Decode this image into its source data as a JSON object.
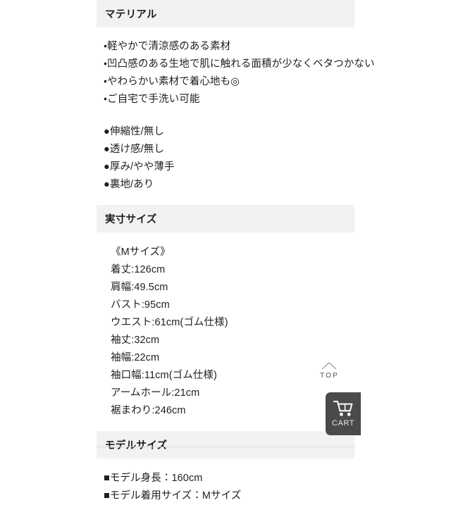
{
  "sections": [
    {
      "id": "material",
      "title": "マテリアル",
      "feature_lines": [
        "・軽やかで清涼感のある素材",
        "・凹凸感のある生地で肌に触れる面積が少なくベタつかない",
        "・やわらかい素材で着心地も◎",
        "・ご自宅で手洗い可能"
      ],
      "spec_lines": [
        "●伸縮性/無し",
        "●透け感/無し",
        "●厚み/やや薄手",
        "●裏地/あり"
      ]
    },
    {
      "id": "measurements",
      "title": "実寸サイズ",
      "size_label": "《Mサイズ》",
      "measures": [
        "着丈:126cm",
        "肩幅:49.5cm",
        "バスト:95cm",
        "ウエスト:61cm(ゴム仕様)",
        "袖丈:32cm",
        "袖幅:22cm",
        "袖口幅:11cm(ゴム仕様)",
        "アームホール:21cm",
        "裾まわり:246cm"
      ]
    },
    {
      "id": "model",
      "title": "モデルサイズ",
      "model_lines": [
        "■モデル身長：160cm",
        "■モデル着用サイズ：Mサイズ"
      ]
    }
  ],
  "floating": {
    "top_button": {
      "label": "TOP",
      "icon": "chevron-up-icon"
    },
    "cart_button": {
      "label": "CART",
      "icon": "shopping-cart-icon"
    }
  },
  "colors": {
    "section_header_bg": "#f2f2f2",
    "text": "#1f1f1f",
    "cart_bg": "#4a4a4a",
    "divider": "#dcdcdc"
  }
}
